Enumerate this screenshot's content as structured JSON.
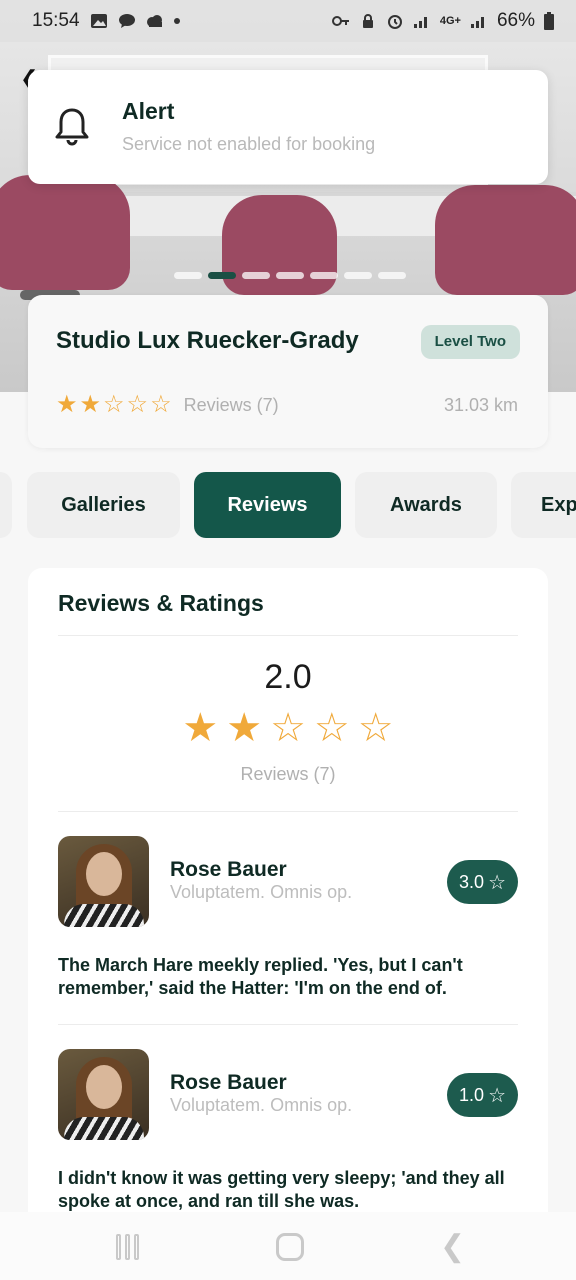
{
  "status_bar": {
    "time": "15:54",
    "network": "4G+",
    "battery": "66%"
  },
  "alert": {
    "title": "Alert",
    "message": "Service not enabled for booking"
  },
  "salon": {
    "name": "Studio Lux Ruecker-Grady",
    "level": "Level Two",
    "rating": 2,
    "max_rating": 5,
    "reviews_label": "Reviews (7)",
    "distance": "31.03 km"
  },
  "carousel": {
    "count": 7,
    "active_index": 1
  },
  "tabs": [
    {
      "label": "Galleries",
      "active": false
    },
    {
      "label": "Reviews",
      "active": true
    },
    {
      "label": "Awards",
      "active": false
    },
    {
      "label": "Exp",
      "active": false
    }
  ],
  "reviews_panel": {
    "title": "Reviews & Ratings",
    "average": "2.0",
    "average_stars": 2,
    "reviews_label": "Reviews (7)"
  },
  "reviews": [
    {
      "name": "Rose Bauer",
      "subtitle": "Voluptatem. Omnis op.",
      "rating": "3.0",
      "text": "The March Hare meekly replied. 'Yes, but I can't remember,' said the Hatter: 'I'm on the end of."
    },
    {
      "name": "Rose Bauer",
      "subtitle": "Voluptatem. Omnis op.",
      "rating": "1.0",
      "text": "I didn't know it was getting very sleepy; 'and they all spoke at once, and ran till she was."
    }
  ],
  "colors": {
    "brand": "#14574a",
    "star": "#f0a93a",
    "badge_bg": "#cfe1db"
  }
}
